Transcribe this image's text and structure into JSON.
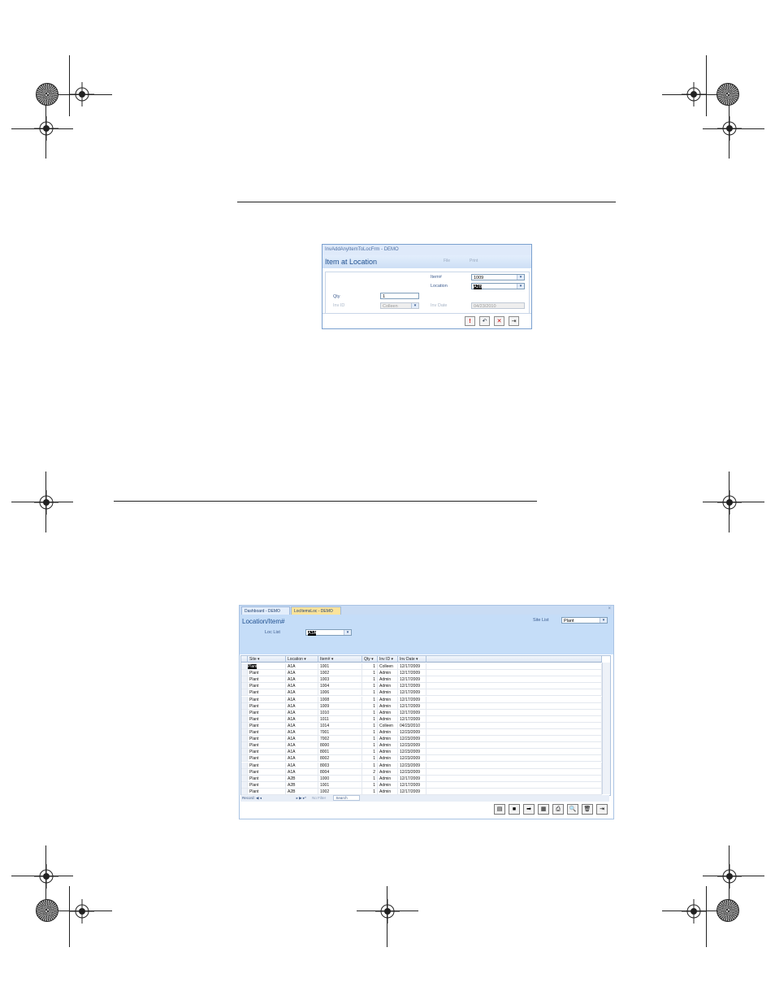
{
  "form_window": {
    "title": "InvAddAnyItemToLocFrm - DEMO",
    "form_title": "Item at Location",
    "header_labels": [
      "File",
      "Print"
    ],
    "fields": {
      "item_label": "Item#",
      "item_value": "1009",
      "location_label": "Location",
      "location_value": "A2B",
      "qty_label": "Qty",
      "qty_value": "1",
      "invid_label": "Inv ID",
      "invid_value": "Colleen",
      "invdate_label": "Inv Date",
      "invdate_value": "04/23/2010"
    },
    "buttons": {
      "run": "!",
      "undo": "↶",
      "delete": "✕",
      "exit": "⇥"
    }
  },
  "datasheet_window": {
    "tabs": [
      {
        "label": "Dashboard - DEMO",
        "active": false
      },
      {
        "label": "LocItemsLoc - DEMO",
        "active": true
      }
    ],
    "close_glyph": "×",
    "form_title": "Location/Item#",
    "site_list_label": "Site List",
    "site_list_value": "Plant",
    "loc_list_label": "Loc List",
    "loc_list_value": "A1A",
    "columns": [
      "Site",
      "Location",
      "Item#",
      "Qty",
      "Inv ID",
      "Inv Date"
    ],
    "rows": [
      [
        "Plant",
        "A1A",
        "1001",
        "1",
        "Colleen",
        "12/17/2009"
      ],
      [
        "Plant",
        "A1A",
        "1002",
        "1",
        "Admin",
        "12/17/2009"
      ],
      [
        "Plant",
        "A1A",
        "1003",
        "1",
        "Admin",
        "12/17/2009"
      ],
      [
        "Plant",
        "A1A",
        "1004",
        "1",
        "Admin",
        "12/17/2009"
      ],
      [
        "Plant",
        "A1A",
        "1006",
        "1",
        "Admin",
        "12/17/2009"
      ],
      [
        "Plant",
        "A1A",
        "1008",
        "1",
        "Admin",
        "12/17/2009"
      ],
      [
        "Plant",
        "A1A",
        "1009",
        "1",
        "Admin",
        "12/17/2009"
      ],
      [
        "Plant",
        "A1A",
        "1010",
        "1",
        "Admin",
        "12/17/2009"
      ],
      [
        "Plant",
        "A1A",
        "1011",
        "1",
        "Admin",
        "12/17/2009"
      ],
      [
        "Plant",
        "A1A",
        "1014",
        "1",
        "Colleen",
        "04/23/2010"
      ],
      [
        "Plant",
        "A1A",
        "7001",
        "1",
        "Admin",
        "12/23/2009"
      ],
      [
        "Plant",
        "A1A",
        "7002",
        "1",
        "Admin",
        "12/23/2009"
      ],
      [
        "Plant",
        "A1A",
        "8000",
        "1",
        "Admin",
        "12/23/2009"
      ],
      [
        "Plant",
        "A1A",
        "8001",
        "1",
        "Admin",
        "12/23/2009"
      ],
      [
        "Plant",
        "A1A",
        "8002",
        "1",
        "Admin",
        "12/23/2009"
      ],
      [
        "Plant",
        "A1A",
        "8003",
        "1",
        "Admin",
        "12/23/2009"
      ],
      [
        "Plant",
        "A1A",
        "8004",
        "2",
        "Admin",
        "12/23/2009"
      ],
      [
        "Plant",
        "A2B",
        "1000",
        "1",
        "Admin",
        "12/17/2009"
      ],
      [
        "Plant",
        "A2B",
        "1001",
        "1",
        "Admin",
        "12/17/2009"
      ],
      [
        "Plant",
        "A2B",
        "1002",
        "1",
        "Admin",
        "12/17/2009"
      ]
    ],
    "record_nav": {
      "record_label": "Record:",
      "nav_first": "◀",
      "nav_prev": "◂",
      "nav_next": "▸",
      "nav_last": "▶",
      "nav_new": "▸*",
      "filter_label": "No Filter",
      "search_label": "Search"
    },
    "footer_buttons": [
      "▤",
      "■",
      "➡",
      "▦",
      "⎙",
      "🔍",
      "🗑",
      "⇥"
    ]
  },
  "colors": {
    "header_blue": "#c5ddf8",
    "active_tab": "#fbe39a",
    "title_text": "#1f4f8f"
  }
}
